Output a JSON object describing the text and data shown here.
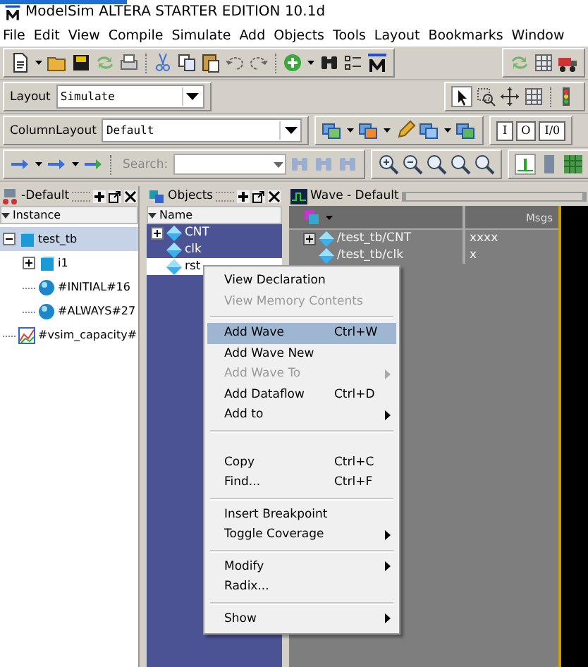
{
  "window": {
    "title": "ModelSim ALTERA STARTER EDITION 10.1d"
  },
  "menu": [
    "File",
    "Edit",
    "View",
    "Compile",
    "Simulate",
    "Add",
    "Objects",
    "Tools",
    "Layout",
    "Bookmarks",
    "Window"
  ],
  "toolbar": {
    "layout_label": "Layout",
    "layout_value": "Simulate",
    "column_layout_label": "ColumnLayout",
    "column_layout_value": "Default",
    "search_label": "Search:",
    "port_buttons": [
      "I",
      "O",
      "I/0"
    ]
  },
  "instance_pane": {
    "title": "-Default",
    "column": "Instance",
    "tree": [
      {
        "label": "test_tb",
        "kind": "module",
        "expanded": true,
        "selected": true,
        "children": [
          {
            "label": "i1",
            "kind": "module",
            "expanded": false,
            "selected": false
          },
          {
            "label": "#INITIAL#16",
            "kind": "process",
            "selected": false
          },
          {
            "label": "#ALWAYS#27",
            "kind": "process",
            "selected": false
          }
        ]
      },
      {
        "label": "#vsim_capacity#",
        "kind": "capacity",
        "selected": false
      }
    ]
  },
  "objects_pane": {
    "title": "Objects",
    "column": "Name",
    "rows": [
      {
        "label": "CNT",
        "expandable": true,
        "selected": true
      },
      {
        "label": "clk",
        "expandable": false,
        "selected": true
      },
      {
        "label": "rst",
        "expandable": false,
        "selected": false
      }
    ]
  },
  "wave_pane": {
    "title": "Wave - Default",
    "msgs_header": "Msgs",
    "rows": [
      {
        "signal": "/test_tb/CNT",
        "value": "xxxx",
        "expandable": true
      },
      {
        "signal": "/test_tb/clk",
        "value": "x",
        "expandable": false
      }
    ]
  },
  "context_menu": {
    "groups": [
      [
        {
          "label": "View Declaration",
          "disabled": false,
          "selected": false,
          "submenu": false
        },
        {
          "label": "View Memory Contents",
          "disabled": true,
          "selected": false,
          "submenu": false
        }
      ],
      [
        {
          "label": "Add Wave",
          "shortcut": "Ctrl+W",
          "disabled": false,
          "selected": true,
          "submenu": false
        },
        {
          "label": "Add Wave New",
          "disabled": false,
          "selected": false,
          "submenu": false
        },
        {
          "label": "Add Wave To",
          "disabled": true,
          "selected": false,
          "submenu": true
        },
        {
          "label": "Add Dataflow",
          "shortcut": "Ctrl+D",
          "disabled": false,
          "selected": false,
          "submenu": false
        },
        {
          "label": "Add to",
          "disabled": false,
          "selected": false,
          "submenu": true
        }
      ],
      [
        {
          "label": "Copy",
          "shortcut": "Ctrl+C",
          "disabled": false,
          "selected": false,
          "submenu": false
        },
        {
          "label": "Find...",
          "shortcut": "Ctrl+F",
          "disabled": false,
          "selected": false,
          "submenu": false
        }
      ],
      [
        {
          "label": "Insert Breakpoint",
          "disabled": false,
          "selected": false,
          "submenu": false
        },
        {
          "label": "Toggle Coverage",
          "disabled": false,
          "selected": false,
          "submenu": true
        }
      ],
      [
        {
          "label": "Modify",
          "disabled": false,
          "selected": false,
          "submenu": true
        },
        {
          "label": "Radix...",
          "disabled": false,
          "selected": false,
          "submenu": false
        }
      ],
      [
        {
          "label": "Show",
          "disabled": false,
          "selected": false,
          "submenu": true
        }
      ]
    ]
  }
}
